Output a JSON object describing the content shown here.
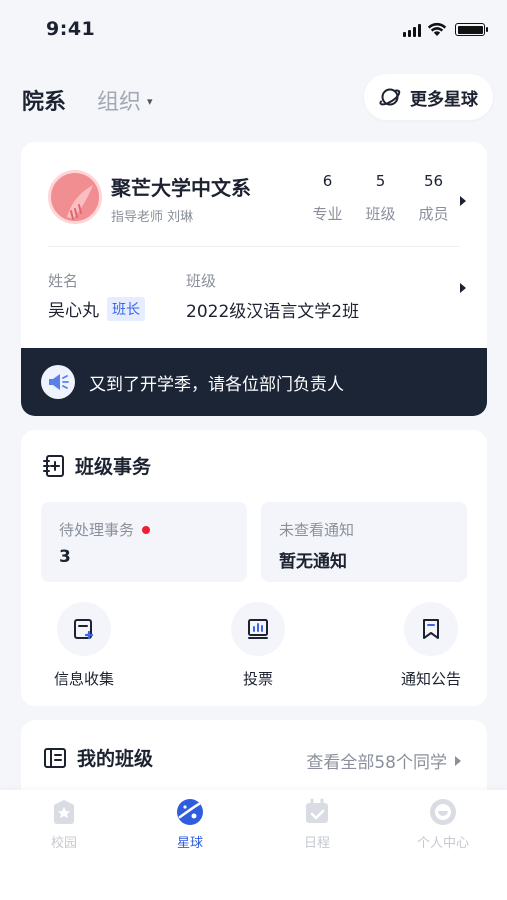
{
  "status_bar": {
    "time": "9:41"
  },
  "header": {
    "tab_active": "院系",
    "tab_inactive": "组织",
    "more_button": "更多星球"
  },
  "department": {
    "name": "聚芒大学中文系",
    "teacher": "指导老师 刘琳",
    "stats": [
      {
        "value": "6",
        "label": "专业"
      },
      {
        "value": "5",
        "label": "班级"
      },
      {
        "value": "56",
        "label": "成员"
      }
    ],
    "name_label": "姓名",
    "class_label": "班级",
    "student_name": "吴心丸",
    "role_badge": "班长",
    "class_name": "2022级汉语言文学2班",
    "notice": "又到了开学季，请各位部门负责人"
  },
  "affairs": {
    "title": "班级事务",
    "pending_label": "待处理事务",
    "pending_value": "3",
    "unread_label": "未查看通知",
    "unread_value": "暂无通知",
    "actions": [
      {
        "label": "信息收集",
        "icon": "form-collect-icon"
      },
      {
        "label": "投票",
        "icon": "vote-icon"
      },
      {
        "label": "通知公告",
        "icon": "bookmark-icon"
      }
    ]
  },
  "my_class": {
    "title": "我的班级",
    "see_all": "查看全部58个同学"
  },
  "tabbar": {
    "items": [
      {
        "label": "校园",
        "icon": "campus-icon",
        "active": false
      },
      {
        "label": "星球",
        "icon": "planet-icon",
        "active": true
      },
      {
        "label": "日程",
        "icon": "calendar-icon",
        "active": false
      },
      {
        "label": "个人中心",
        "icon": "profile-icon",
        "active": false
      }
    ]
  },
  "colors": {
    "accent": "#2f5ddd",
    "notice_bg": "#1b2536",
    "badge_bg": "#e6edff",
    "red_dot": "#ef1f2c",
    "logo_pink": "#f08e92"
  }
}
